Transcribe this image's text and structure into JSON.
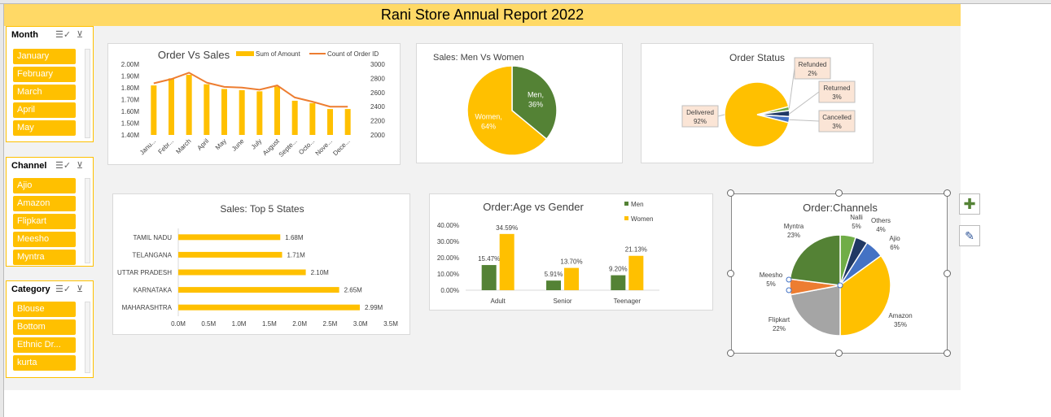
{
  "report_title": "Rani Store Annual Report 2022",
  "slicers": [
    {
      "title": "Month",
      "items": [
        "January",
        "February",
        "March",
        "April",
        "May"
      ]
    },
    {
      "title": "Channel",
      "items": [
        "Ajio",
        "Amazon",
        "Flipkart",
        "Meesho",
        "Myntra"
      ]
    },
    {
      "title": "Category",
      "items": [
        "Blouse",
        "Bottom",
        "Ethnic Dr...",
        "kurta"
      ]
    }
  ],
  "icons": {
    "multi_select": "multi-select-icon",
    "clear_filter": "clear-filter-icon",
    "add_element": "plus-icon",
    "chart_style": "brush-icon"
  },
  "colors": {
    "accent": "#ffc000",
    "green": "#548235",
    "line": "#ed7d31",
    "banner": "#ffd966",
    "blue": "#4472c4",
    "navy": "#203864",
    "grey": "#a5a5a5",
    "lightgreen": "#70ad47"
  },
  "chart_data": [
    {
      "id": "order-vs-sales",
      "type": "bar",
      "title": "Order Vs Sales",
      "categories": [
        "Janu...",
        "Febr...",
        "March",
        "April",
        "May",
        "June",
        "July",
        "August",
        "Septe...",
        "Octo...",
        "Nove...",
        "Dece..."
      ],
      "series": [
        {
          "name": "Sum of Amount",
          "type": "bar",
          "axis": "left",
          "values": [
            1.82,
            1.88,
            1.91,
            1.83,
            1.79,
            1.78,
            1.77,
            1.81,
            1.69,
            1.67,
            1.62,
            1.62
          ]
        },
        {
          "name": "Count of Order ID",
          "type": "line",
          "axis": "right",
          "values": [
            2730,
            2790,
            2880,
            2740,
            2680,
            2670,
            2640,
            2700,
            2530,
            2470,
            2400,
            2400
          ]
        }
      ],
      "y_left_ticks": [
        "1.40M",
        "1.50M",
        "1.60M",
        "1.70M",
        "1.80M",
        "1.90M",
        "2.00M"
      ],
      "ylim_left": [
        1.4,
        2.0
      ],
      "y_right_ticks": [
        "2000",
        "2200",
        "2400",
        "2600",
        "2800",
        "3000"
      ],
      "ylim_right": [
        2000,
        3000
      ],
      "legend": "top-right"
    },
    {
      "id": "men-vs-women",
      "type": "pie",
      "title": "Sales: Men Vs Women",
      "labels": [
        "Men",
        "Women"
      ],
      "values": [
        36,
        64
      ],
      "value_labels": [
        "36%",
        "64%"
      ]
    },
    {
      "id": "order-status",
      "type": "pie",
      "title": "Order Status",
      "labels": [
        "Delivered",
        "Refunded",
        "Returned",
        "Cancelled"
      ],
      "values": [
        92,
        2,
        3,
        3
      ],
      "value_labels": [
        "92%",
        "2%",
        "3%",
        "3%"
      ]
    },
    {
      "id": "top-states",
      "type": "bar",
      "orientation": "horizontal",
      "title": "Sales: Top 5 States",
      "categories": [
        "TAMIL NADU",
        "TELANGANA",
        "UTTAR PRADESH",
        "KARNATAKA",
        "MAHARASHTRA"
      ],
      "values": [
        1.68,
        1.71,
        2.1,
        2.65,
        2.99
      ],
      "value_labels": [
        "1.68M",
        "1.71M",
        "2.10M",
        "2.65M",
        "2.99M"
      ],
      "x_ticks": [
        "0.0M",
        "0.5M",
        "1.0M",
        "1.5M",
        "2.0M",
        "2.5M",
        "3.0M",
        "3.5M"
      ],
      "xlim": [
        0,
        3.5
      ]
    },
    {
      "id": "age-vs-gender",
      "type": "bar",
      "title": "Order:Age vs Gender",
      "categories": [
        "Adult",
        "Senior",
        "Teenager"
      ],
      "series": [
        {
          "name": "Men",
          "values": [
            15.47,
            5.91,
            9.2
          ],
          "value_labels": [
            "15.47%",
            "5.91%",
            "9.20%"
          ]
        },
        {
          "name": "Women",
          "values": [
            34.59,
            13.7,
            21.13
          ],
          "value_labels": [
            "34.59%",
            "13.70%",
            "21.13%"
          ]
        }
      ],
      "y_ticks": [
        "0.00%",
        "10.00%",
        "20.00%",
        "30.00%",
        "40.00%"
      ],
      "ylim": [
        0,
        40
      ],
      "legend": "top-right"
    },
    {
      "id": "channels",
      "type": "pie",
      "title": "Order:Channels",
      "labels": [
        "Nalli",
        "Others",
        "Ajio",
        "Amazon",
        "Flipkart",
        "Meesho",
        "Myntra"
      ],
      "values": [
        5,
        4,
        6,
        35,
        22,
        5,
        23
      ],
      "value_labels": [
        "5%",
        "4%",
        "6%",
        "35%",
        "22%",
        "5%",
        "23%"
      ]
    }
  ]
}
